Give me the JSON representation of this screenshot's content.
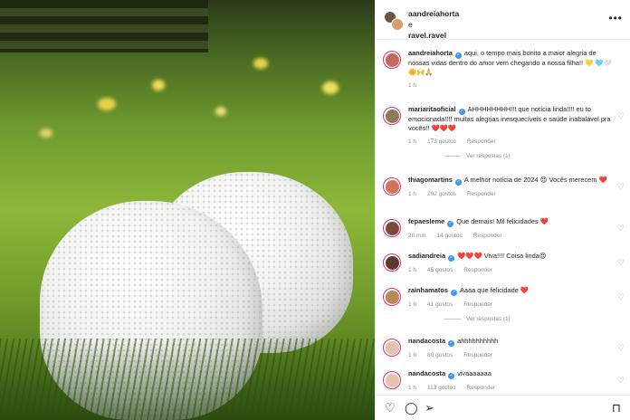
{
  "header": {
    "user1": "aandreiahorta",
    "conj": "e",
    "user2": "ravel.ravel"
  },
  "comments": [
    {
      "user": "aandreiahorta",
      "verified": true,
      "text": "aqui, o tempo mais bonito a maior alegria de nossas vidas dentro do amor vem chegando a nossa filha!! 💛 🩵🤍🌼🙌🙏",
      "time": "1 h",
      "likes": "",
      "avatar_color": "#c26b5a"
    },
    {
      "user": "mariaritaoficial",
      "verified": true,
      "text": "AHHHHHHHH!!! que notícia linda!!!! eu to emocionada!!!! muitas alegrias inesquecíveis e saúde inabalável pra vocês!! ❤️❤️❤️",
      "time": "1 h",
      "likes": "173 gostos",
      "reply": "Responder",
      "replies": "Ver respostas (1)",
      "avatar_color": "#8a7a5a"
    },
    {
      "user": "thiagomartins",
      "verified": true,
      "text": "A melhor notícia de 2024 😍 Vocês merecem ❤️",
      "time": "1 h",
      "likes": "202 gostos",
      "reply": "Responder",
      "avatar_color": "#d0745e"
    },
    {
      "user": "fepaesleme",
      "verified": true,
      "text": "Que demais! Mil felicidades ❤️",
      "time": "20 min",
      "likes": "14 gostos",
      "reply": "Responder",
      "avatar_color": "#7a4b3b"
    },
    {
      "user": "sadiandreia",
      "verified": true,
      "text": "❤️❤️❤️ Viva!!!! Coisa linda😍",
      "time": "1 h",
      "likes": "45 gostos",
      "reply": "Responder",
      "avatar_color": "#5b3a2c"
    },
    {
      "user": "rainhamatos",
      "verified": true,
      "text": "Aaaa que felicidade ❤️",
      "time": "1 h",
      "likes": "41 gostos",
      "reply": "Responder",
      "replies": "Ver respostas (1)",
      "avatar_color": "#b88a5a"
    },
    {
      "user": "nandacosta",
      "verified": true,
      "text": "ahhhhhhhhhh",
      "time": "1 h",
      "likes": "80 gostos",
      "reply": "Responder",
      "avatar_color": "#e3c3b0"
    },
    {
      "user": "nandacosta",
      "verified": true,
      "text": "vivaaaaaaa",
      "time": "1 h",
      "likes": "113 gostos",
      "reply": "Responder",
      "avatar_color": "#e3c3b0"
    }
  ],
  "icons": {
    "like": "heart-icon",
    "comment": "comment-icon",
    "share": "send-icon",
    "save": "bookmark-icon",
    "more": "more-icon"
  }
}
